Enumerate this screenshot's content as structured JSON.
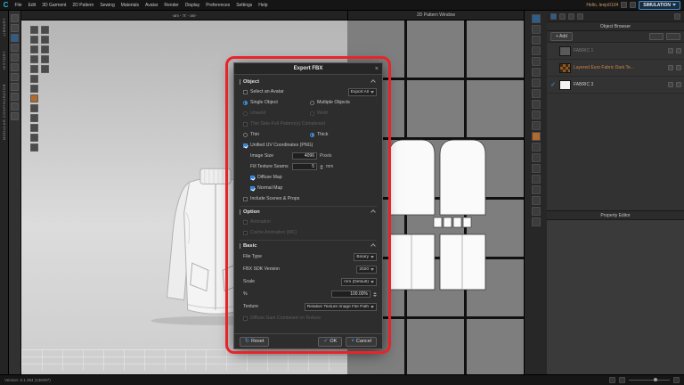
{
  "menubar": {
    "logo": "C",
    "items": [
      "File",
      "Edit",
      "3D Garment",
      "2D Pattern",
      "Sewing",
      "Materials",
      "Avatar",
      "Render",
      "Display",
      "Preferences",
      "Settings",
      "Help"
    ],
    "greeting": "Hello, leejo0104",
    "simulation": "SIMULATION"
  },
  "left_tabs": {
    "library": "LIBRARY",
    "history": "HISTORY",
    "modular": "MODULAR CONFIGURATOR"
  },
  "viewport": {
    "header": "-ani - 'X' - ani-"
  },
  "pattern_window": {
    "title": "2D Pattern Window"
  },
  "object_browser": {
    "title": "Object Browser",
    "add": "+ Add",
    "items": [
      {
        "name": "FABRIC 1"
      },
      {
        "name": "Layered Euro Fabric Dark Te..."
      },
      {
        "name": "FABRIC 3"
      }
    ]
  },
  "property_editor": {
    "title": "Property Editor"
  },
  "statusbar": {
    "version": "Version: 6.1.394 (138497)"
  },
  "glyphs": {
    "close": "×",
    "check": "✓",
    "cancel": "×",
    "reset": "↻"
  },
  "dialog": {
    "title": "Export FBX",
    "sections": {
      "object": "Object",
      "option": "Option",
      "basic": "Basic"
    },
    "object": {
      "select_avatar": "Select an Avatar",
      "export_all": "Export All",
      "single_object": "Single Object",
      "multiple_objects": "Multiple Objects",
      "unweld": "Unweld",
      "weld": "Weld",
      "thin_side": "Thin Side-Full Pattern(s) Complexed",
      "thin": "Thin",
      "thick": "Thick",
      "unified_uv": "Unified UV Coordinates (PNG)",
      "image_size": "Image Size",
      "image_size_value": "4096",
      "image_size_unit": "Pixels",
      "fill_seams": "Fill Texture Seams",
      "fill_seams_value": "5",
      "fill_seams_unit": "mm",
      "diffuse_map": "Diffuse Map",
      "normal_map": "Normal Map",
      "include_scenes": "Include Scenes & Props"
    },
    "option": {
      "animation": "Animation",
      "cache_animation": "Cache Animation (MC)"
    },
    "basic": {
      "file_type": "File Type",
      "file_type_value": "Binary",
      "sdk": "FBX SDK Version",
      "sdk_value": "2020",
      "scale": "Scale",
      "scale_value": "mm (Default)",
      "percent": "%",
      "percent_value": "100.00%",
      "texture": "Texture",
      "texture_value": "Relative Texture Image File Path",
      "diffuse_gain": "Diffuse Gain Combined on Texture"
    },
    "buttons": {
      "reset": "Reset",
      "ok": "OK",
      "cancel": "Cancel"
    }
  }
}
